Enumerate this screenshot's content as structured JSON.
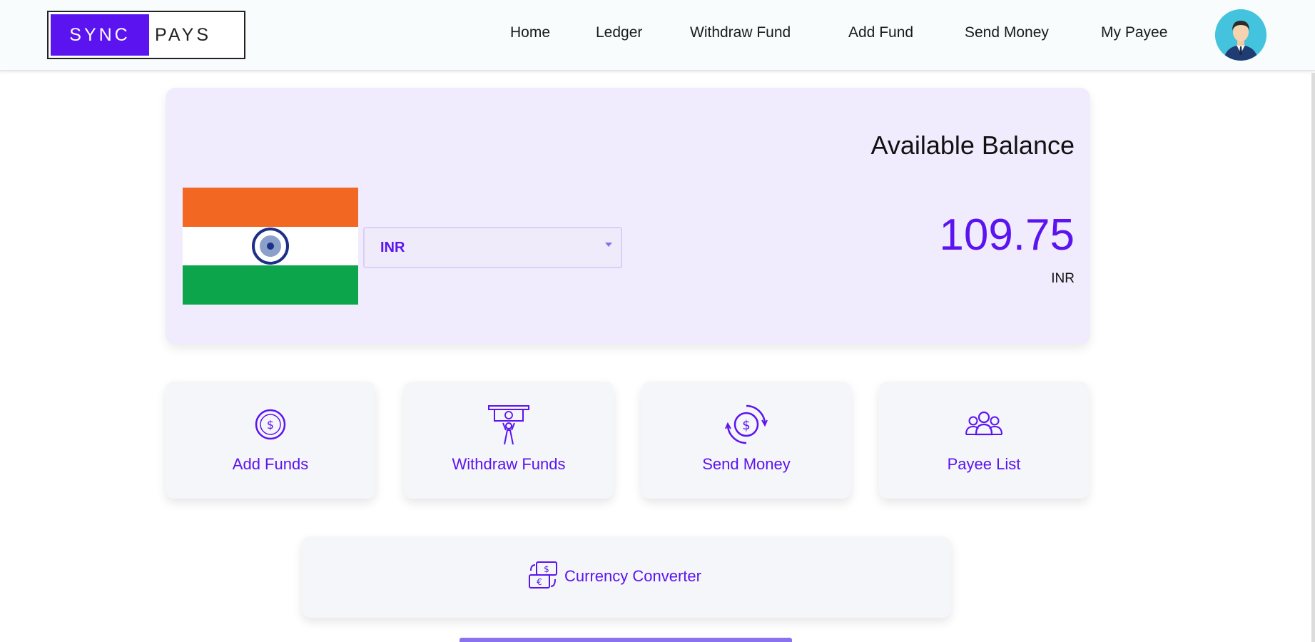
{
  "navbar": {
    "logo": {
      "part1": "SYNC",
      "part2": "PAYS"
    },
    "links": [
      "Home",
      "Ledger",
      "Withdraw Fund",
      "Add Fund",
      "Send Money",
      "My Payee"
    ],
    "avatar_icon": "user-avatar-icon"
  },
  "balance": {
    "title": "Available Balance",
    "amount": "109.75",
    "currency": "INR",
    "flag_icon": "india-flag-icon",
    "selector": {
      "selected": "INR"
    }
  },
  "actions": [
    {
      "label": "Add Funds",
      "icon": "dollar-coin-icon"
    },
    {
      "label": "Withdraw Funds",
      "icon": "withdraw-cash-icon"
    },
    {
      "label": "Send Money",
      "icon": "send-money-cycle-icon"
    },
    {
      "label": "Payee List",
      "icon": "group-users-icon"
    }
  ],
  "converter": {
    "label": "Currency Converter",
    "icon": "currency-exchange-icon"
  },
  "colors": {
    "accent": "#5b14f0",
    "card_bg": "#f1ecfd",
    "tile_bg": "#f5f6f9",
    "flag_saffron": "#f26722",
    "flag_green": "#0ca54c",
    "chakra_blue": "#1d2f86"
  }
}
